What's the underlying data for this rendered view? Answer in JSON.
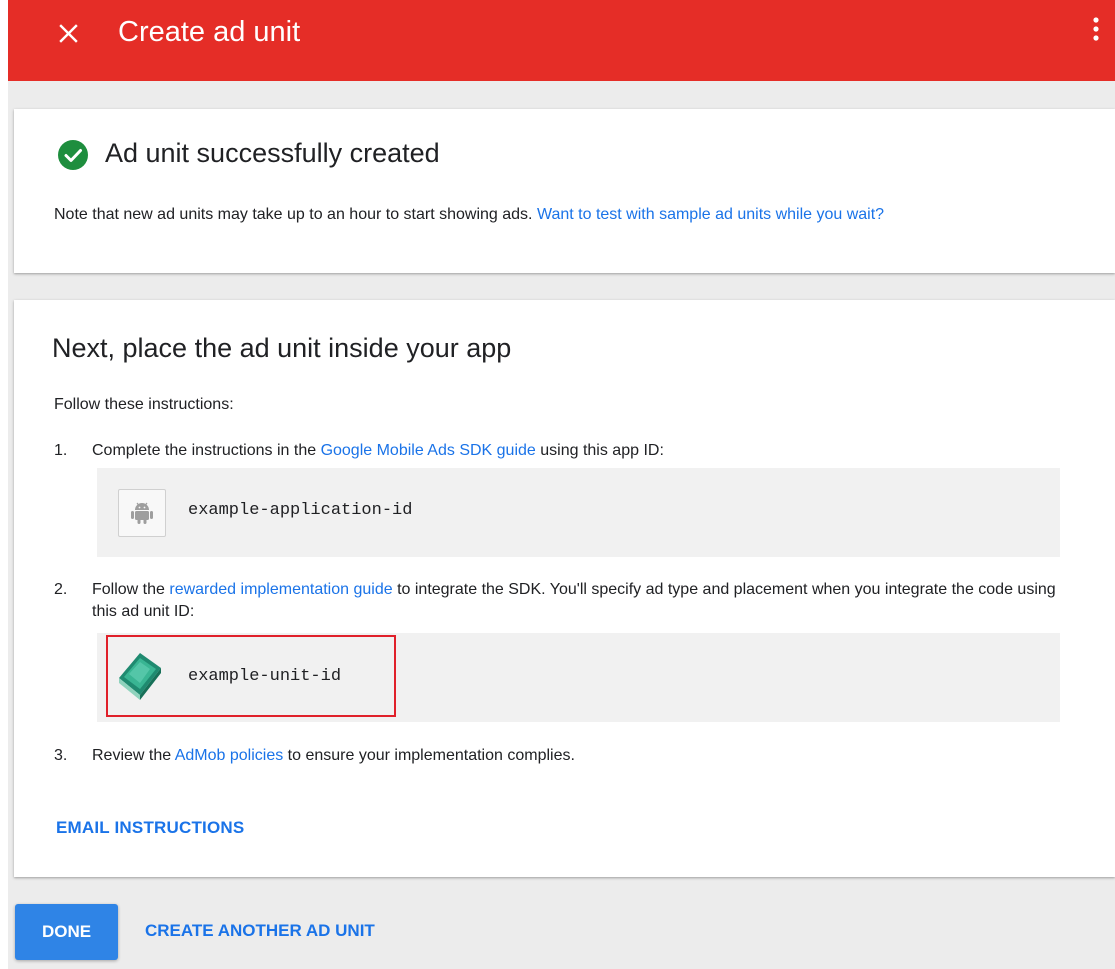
{
  "header": {
    "title": "Create ad unit",
    "close_icon": "close-icon",
    "more_icon": "more-vert-icon",
    "color": "#e52d27"
  },
  "success_card": {
    "title": "Ad unit successfully created",
    "note_text": "Note that new ad units may take up to an hour to start showing ads. ",
    "note_link": "Want to test with sample ad units while you wait?",
    "icon": "check-circle-icon",
    "icon_color": "#1e8e3e"
  },
  "instructions_card": {
    "title": "Next, place the ad unit inside your app",
    "intro": "Follow these instructions:",
    "steps": [
      {
        "num": "1.",
        "before": "Complete the instructions in the ",
        "link": "Google Mobile Ads SDK guide",
        "after": " using this app ID:",
        "code": "example-application-id",
        "icon": "android-icon"
      },
      {
        "num": "2.",
        "before": "Follow the ",
        "link": "rewarded implementation guide",
        "after": " to integrate the SDK. You'll specify ad type and placement when you integrate the code using this ad unit ID:",
        "code": "example-unit-id",
        "icon": "gem-icon"
      },
      {
        "num": "3.",
        "before": "Review the ",
        "link": "AdMob policies",
        "after": " to ensure your implementation complies."
      }
    ],
    "email_button": "EMAIL INSTRUCTIONS"
  },
  "footer": {
    "done_button": "DONE",
    "create_another_button": "CREATE ANOTHER AD UNIT",
    "accent_color": "#1a73e8"
  }
}
